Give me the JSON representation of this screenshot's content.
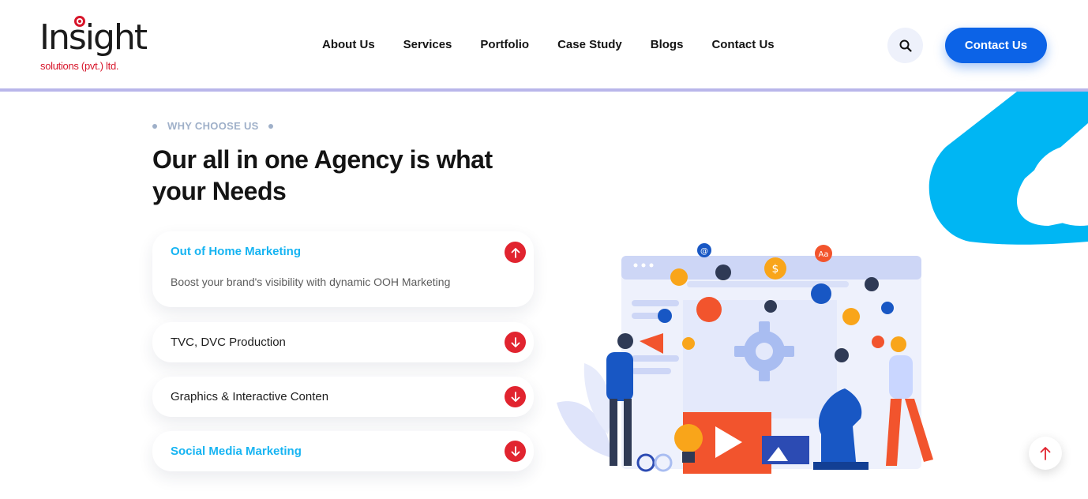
{
  "logo": {
    "word": "Insight",
    "tagline": "solutions (pvt.) ltd."
  },
  "nav": {
    "items": [
      {
        "label": "About Us"
      },
      {
        "label": "Services"
      },
      {
        "label": "Portfolio"
      },
      {
        "label": "Case Study"
      },
      {
        "label": "Blogs"
      },
      {
        "label": "Contact Us"
      }
    ],
    "search_icon": "search-icon",
    "cta_label": "Contact Us"
  },
  "section": {
    "eyebrow": "WHY CHOOSE US",
    "title": "Our all in one Agency is what your Needs"
  },
  "accordion": {
    "items": [
      {
        "title": "Out of Home Marketing",
        "body": "Boost your brand's visibility with dynamic OOH Marketing",
        "state": "expanded",
        "icon": "arrow-up-icon"
      },
      {
        "title": "TVC, DVC Production",
        "state": "collapsed",
        "icon": "arrow-down-icon"
      },
      {
        "title": "Graphics & Interactive Conten",
        "state": "collapsed",
        "icon": "arrow-down-icon"
      },
      {
        "title": "Social Media Marketing",
        "state": "collapsed",
        "icon": "arrow-down-icon"
      }
    ]
  },
  "illustration": {
    "icon_glyphs": [
      "@",
      "$",
      "Aa"
    ]
  },
  "colors": {
    "brand_red": "#d7152a",
    "cta_blue": "#0c63e7",
    "accent_cyan": "#16b4f2",
    "accordion_btn_red": "#e1242f",
    "deco_blue": "#00b6f3"
  }
}
